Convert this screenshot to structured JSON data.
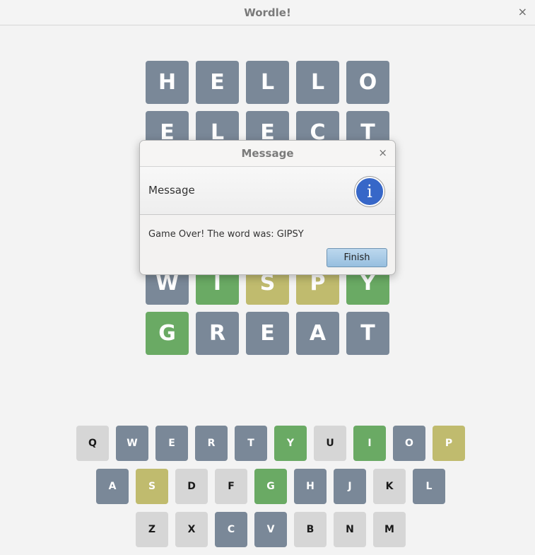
{
  "window": {
    "title": "Wordle!",
    "close_glyph": "×"
  },
  "colors": {
    "gray": "#7a8898",
    "green": "#6aaa64",
    "yellow": "#c0bb6e",
    "light": "#d6d6d6"
  },
  "board": {
    "rows": [
      [
        {
          "letter": "H",
          "state": "gray"
        },
        {
          "letter": "E",
          "state": "gray"
        },
        {
          "letter": "L",
          "state": "gray"
        },
        {
          "letter": "L",
          "state": "gray"
        },
        {
          "letter": "O",
          "state": "gray"
        }
      ],
      [
        {
          "letter": "E",
          "state": "gray"
        },
        {
          "letter": "L",
          "state": "gray"
        },
        {
          "letter": "E",
          "state": "gray"
        },
        {
          "letter": "C",
          "state": "gray"
        },
        {
          "letter": "T",
          "state": "gray"
        }
      ],
      [
        {
          "letter": "",
          "state": "hidden"
        },
        {
          "letter": "",
          "state": "hidden"
        },
        {
          "letter": "",
          "state": "hidden"
        },
        {
          "letter": "",
          "state": "hidden"
        },
        {
          "letter": "",
          "state": "hidden"
        }
      ],
      [
        {
          "letter": "",
          "state": "hidden"
        },
        {
          "letter": "",
          "state": "hidden"
        },
        {
          "letter": "",
          "state": "hidden"
        },
        {
          "letter": "",
          "state": "hidden"
        },
        {
          "letter": "",
          "state": "hidden"
        }
      ],
      [
        {
          "letter": "W",
          "state": "gray"
        },
        {
          "letter": "I",
          "state": "green"
        },
        {
          "letter": "S",
          "state": "yellow"
        },
        {
          "letter": "P",
          "state": "yellow"
        },
        {
          "letter": "Y",
          "state": "green"
        }
      ],
      [
        {
          "letter": "G",
          "state": "green"
        },
        {
          "letter": "R",
          "state": "gray"
        },
        {
          "letter": "E",
          "state": "gray"
        },
        {
          "letter": "A",
          "state": "gray"
        },
        {
          "letter": "T",
          "state": "gray"
        }
      ]
    ]
  },
  "keyboard": {
    "rows": [
      [
        {
          "key": "Q",
          "state": "light"
        },
        {
          "key": "W",
          "state": "gray"
        },
        {
          "key": "E",
          "state": "gray"
        },
        {
          "key": "R",
          "state": "gray"
        },
        {
          "key": "T",
          "state": "gray"
        },
        {
          "key": "Y",
          "state": "green"
        },
        {
          "key": "U",
          "state": "light"
        },
        {
          "key": "I",
          "state": "green"
        },
        {
          "key": "O",
          "state": "gray"
        },
        {
          "key": "P",
          "state": "yellow"
        }
      ],
      [
        {
          "key": "A",
          "state": "gray"
        },
        {
          "key": "S",
          "state": "yellow"
        },
        {
          "key": "D",
          "state": "light"
        },
        {
          "key": "F",
          "state": "light"
        },
        {
          "key": "G",
          "state": "green"
        },
        {
          "key": "H",
          "state": "gray"
        },
        {
          "key": "J",
          "state": "gray"
        },
        {
          "key": "K",
          "state": "light"
        },
        {
          "key": "L",
          "state": "gray"
        }
      ],
      [
        {
          "key": "Z",
          "state": "light"
        },
        {
          "key": "X",
          "state": "light"
        },
        {
          "key": "C",
          "state": "gray"
        },
        {
          "key": "V",
          "state": "gray"
        },
        {
          "key": "B",
          "state": "light"
        },
        {
          "key": "N",
          "state": "light"
        },
        {
          "key": "M",
          "state": "light"
        }
      ]
    ]
  },
  "dialog": {
    "title": "Message",
    "close_glyph": "×",
    "header": "Message",
    "info_glyph": "i",
    "content": "Game Over! The word was: GIPSY",
    "button_label": "Finish"
  }
}
